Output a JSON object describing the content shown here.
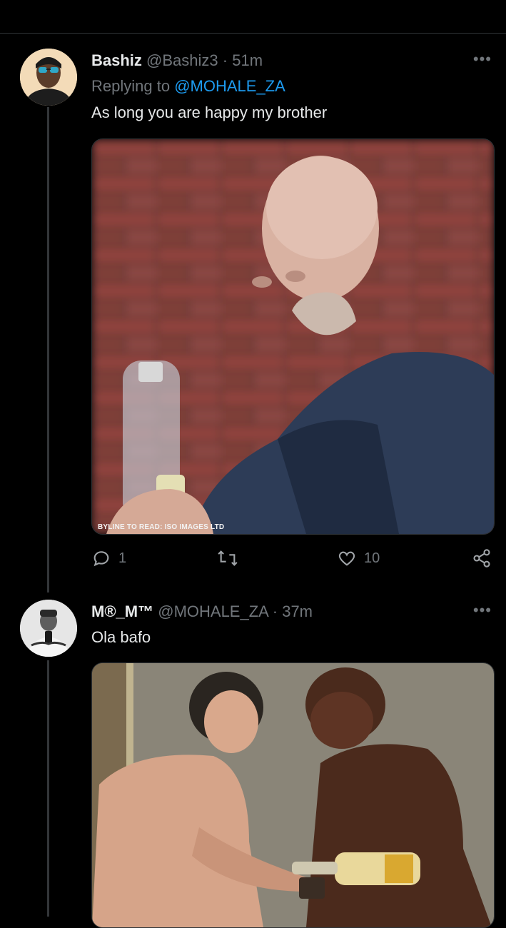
{
  "colors": {
    "background": "#000000",
    "text": "#e7e9ea",
    "muted": "#71767b",
    "accent": "#1d9bf0",
    "divider": "#2f3336"
  },
  "tweets": [
    {
      "display_name": "Bashiz",
      "handle": "@Bashiz3",
      "separator": "·",
      "time": "51m",
      "reply_prefix": "Replying to",
      "reply_handle": "@MOHALE_ZA",
      "text": "As long you are happy my brother",
      "more_icon": "more-icon",
      "media_alt": "Bald man holding a bottle in front of a brick wall",
      "media_credit": "BYLINE TO READ: ISO IMAGES LTD",
      "actions": {
        "reply_count": "1",
        "retweet_count": "",
        "like_count": "10"
      }
    },
    {
      "display_name": "M®_M™",
      "handle": "@MOHALE_ZA",
      "separator": "·",
      "time": "37m",
      "text": "Ola bafo",
      "more_icon": "more-icon",
      "media_alt": "Two men, one pouring a drink from a bottle into a cup"
    }
  ]
}
